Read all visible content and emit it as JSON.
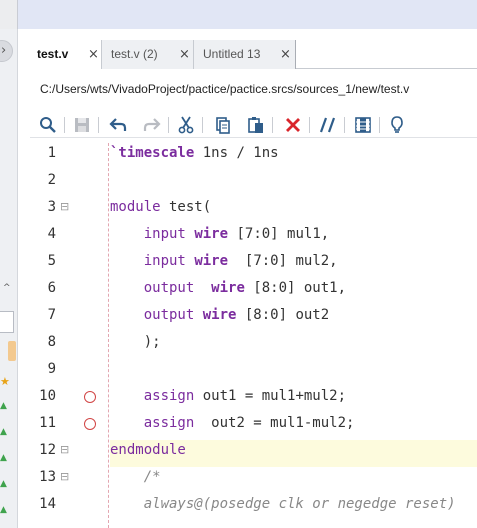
{
  "tabs": [
    {
      "label": "test.v",
      "close": "×",
      "active": true
    },
    {
      "label": "test.v (2)",
      "close": "×",
      "active": false
    },
    {
      "label": "Untitled 13",
      "close": "×",
      "active": false
    }
  ],
  "file_path": "C:/Users/wts/VivadoProject/pactice/pactice.srcs/sources_1/new/test.v",
  "toolbar_icons": [
    "search-icon",
    "save-icon",
    "undo-icon",
    "redo-icon",
    "cut-icon",
    "copy-icon",
    "paste-icon",
    "delete-icon",
    "comment-icon",
    "column-select-icon",
    "bulb-icon"
  ],
  "colors": {
    "keyword": "#7b2c9e",
    "comment": "#888888",
    "breakpoint": "#d14545",
    "current_line": "#fdfbdd"
  },
  "editor": {
    "lines": [
      {
        "n": "1",
        "parts": [
          {
            "t": "`timescale",
            "c": "ty"
          },
          {
            "t": " 1ns / 1ns",
            "c": ""
          }
        ]
      },
      {
        "n": "2",
        "parts": []
      },
      {
        "n": "3",
        "fold": "⊟",
        "parts": [
          {
            "t": "module",
            "c": "kw"
          },
          {
            "t": " test(",
            "c": ""
          }
        ]
      },
      {
        "n": "4",
        "parts": [
          {
            "t": "    ",
            "c": ""
          },
          {
            "t": "input",
            "c": "dir"
          },
          {
            "t": " ",
            "c": ""
          },
          {
            "t": "wire",
            "c": "ty"
          },
          {
            "t": " [7:0] mul1,",
            "c": ""
          }
        ]
      },
      {
        "n": "5",
        "parts": [
          {
            "t": "    ",
            "c": ""
          },
          {
            "t": "input",
            "c": "dir"
          },
          {
            "t": " ",
            "c": ""
          },
          {
            "t": "wire",
            "c": "ty"
          },
          {
            "t": "  [7:0] mul2,",
            "c": ""
          }
        ]
      },
      {
        "n": "6",
        "parts": [
          {
            "t": "    ",
            "c": ""
          },
          {
            "t": "output",
            "c": "dir"
          },
          {
            "t": "  ",
            "c": ""
          },
          {
            "t": "wire",
            "c": "ty"
          },
          {
            "t": " [8:0] out1,",
            "c": ""
          }
        ]
      },
      {
        "n": "7",
        "parts": [
          {
            "t": "    ",
            "c": ""
          },
          {
            "t": "output",
            "c": "dir"
          },
          {
            "t": " ",
            "c": ""
          },
          {
            "t": "wire",
            "c": "ty"
          },
          {
            "t": " [8:0] out2",
            "c": ""
          }
        ]
      },
      {
        "n": "8",
        "parts": [
          {
            "t": "    );",
            "c": ""
          }
        ]
      },
      {
        "n": "9",
        "parts": []
      },
      {
        "n": "10",
        "bp": true,
        "parts": [
          {
            "t": "    ",
            "c": ""
          },
          {
            "t": "assign",
            "c": "kw"
          },
          {
            "t": " out1 = mul1+mul2;",
            "c": ""
          }
        ]
      },
      {
        "n": "11",
        "bp": true,
        "parts": [
          {
            "t": "    ",
            "c": ""
          },
          {
            "t": "assign",
            "c": "kw"
          },
          {
            "t": "  out2 = mul1-mul2;",
            "c": ""
          }
        ]
      },
      {
        "n": "12",
        "fold": "⊟",
        "current": true,
        "parts": [
          {
            "t": "endmodule",
            "c": "kw"
          }
        ]
      },
      {
        "n": "13",
        "fold": "⊟",
        "parts": [
          {
            "t": "    /*",
            "c": "cm"
          }
        ]
      },
      {
        "n": "14",
        "parts": [
          {
            "t": "    always@(posedge clk or negedge reset)",
            "c": "cm"
          }
        ]
      }
    ]
  }
}
